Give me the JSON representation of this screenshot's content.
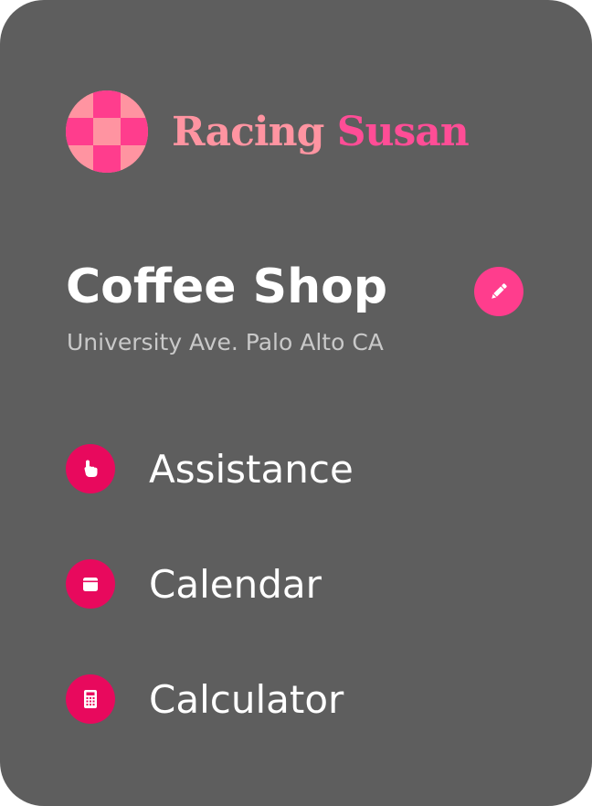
{
  "brand": {
    "name_part1": "Racing",
    "name_part2": "Susan",
    "logo_icon": "checkered-circle-logo",
    "colors": {
      "light_pink": "#ff94a1",
      "hot_pink": "#ff4d96"
    }
  },
  "location": {
    "title": "Coffee Shop",
    "subtitle": "University Ave. Palo Alto CA",
    "edit_icon": "pencil-icon"
  },
  "menu": {
    "items": [
      {
        "label": "Assistance",
        "icon": "hand-pointer-icon"
      },
      {
        "label": "Calendar",
        "icon": "calendar-icon"
      },
      {
        "label": "Calculator",
        "icon": "calculator-icon"
      }
    ]
  },
  "theme": {
    "card_background": "#5e5e5e",
    "accent": "#e8095d",
    "edit_button": "#ff3d8d"
  }
}
